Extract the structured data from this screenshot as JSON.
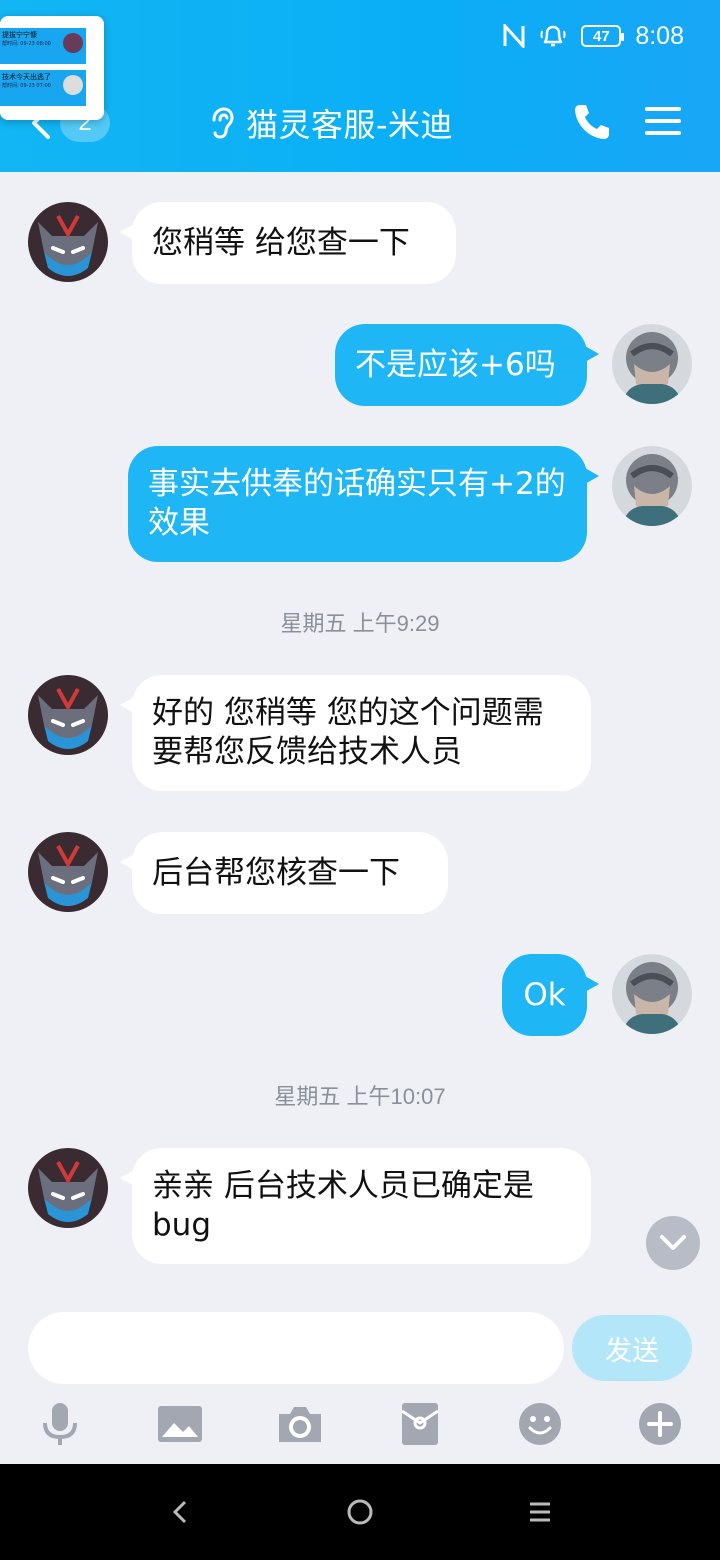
{
  "status_bar": {
    "time": "8:08",
    "battery": "47"
  },
  "header": {
    "title": "猫灵客服-米迪",
    "unread_count": "2"
  },
  "floating_window": {
    "items": [
      {
        "title": "提拔宁宁慷",
        "subtitle": "帮时间: 09-23 08:00"
      },
      {
        "title": "技术今天出逃了",
        "subtitle": "帮时间: 09-23 07:00"
      }
    ]
  },
  "messages": [
    {
      "side": "in",
      "text": "您稍等 给您查一下"
    },
    {
      "side": "out",
      "text": "不是应该+6吗"
    },
    {
      "side": "out",
      "text": "事实去供奉的话确实只有+2的效果"
    },
    {
      "side": "in",
      "text": "好的 您稍等 您的这个问题需要帮您反馈给技术人员"
    },
    {
      "side": "in",
      "text": "后台帮您核查一下"
    },
    {
      "side": "out",
      "text": "Ok"
    },
    {
      "side": "in",
      "text": "亲亲 后台技术人员已确定是bug"
    }
  ],
  "timestamps": [
    "星期五 上午9:29",
    "星期五 上午10:07"
  ],
  "composer": {
    "value": "",
    "placeholder": "",
    "send_label": "发送"
  },
  "toolbar": [
    "microphone-icon",
    "image-icon",
    "camera-icon",
    "red-packet-icon",
    "emoji-icon",
    "plus-icon"
  ],
  "colors": {
    "header": "#0aaef6",
    "outgoing_bubble": "#1fb6f5",
    "incoming_bubble": "#ffffff",
    "background": "#eef0f5",
    "send_button": "#b4e6f9"
  }
}
